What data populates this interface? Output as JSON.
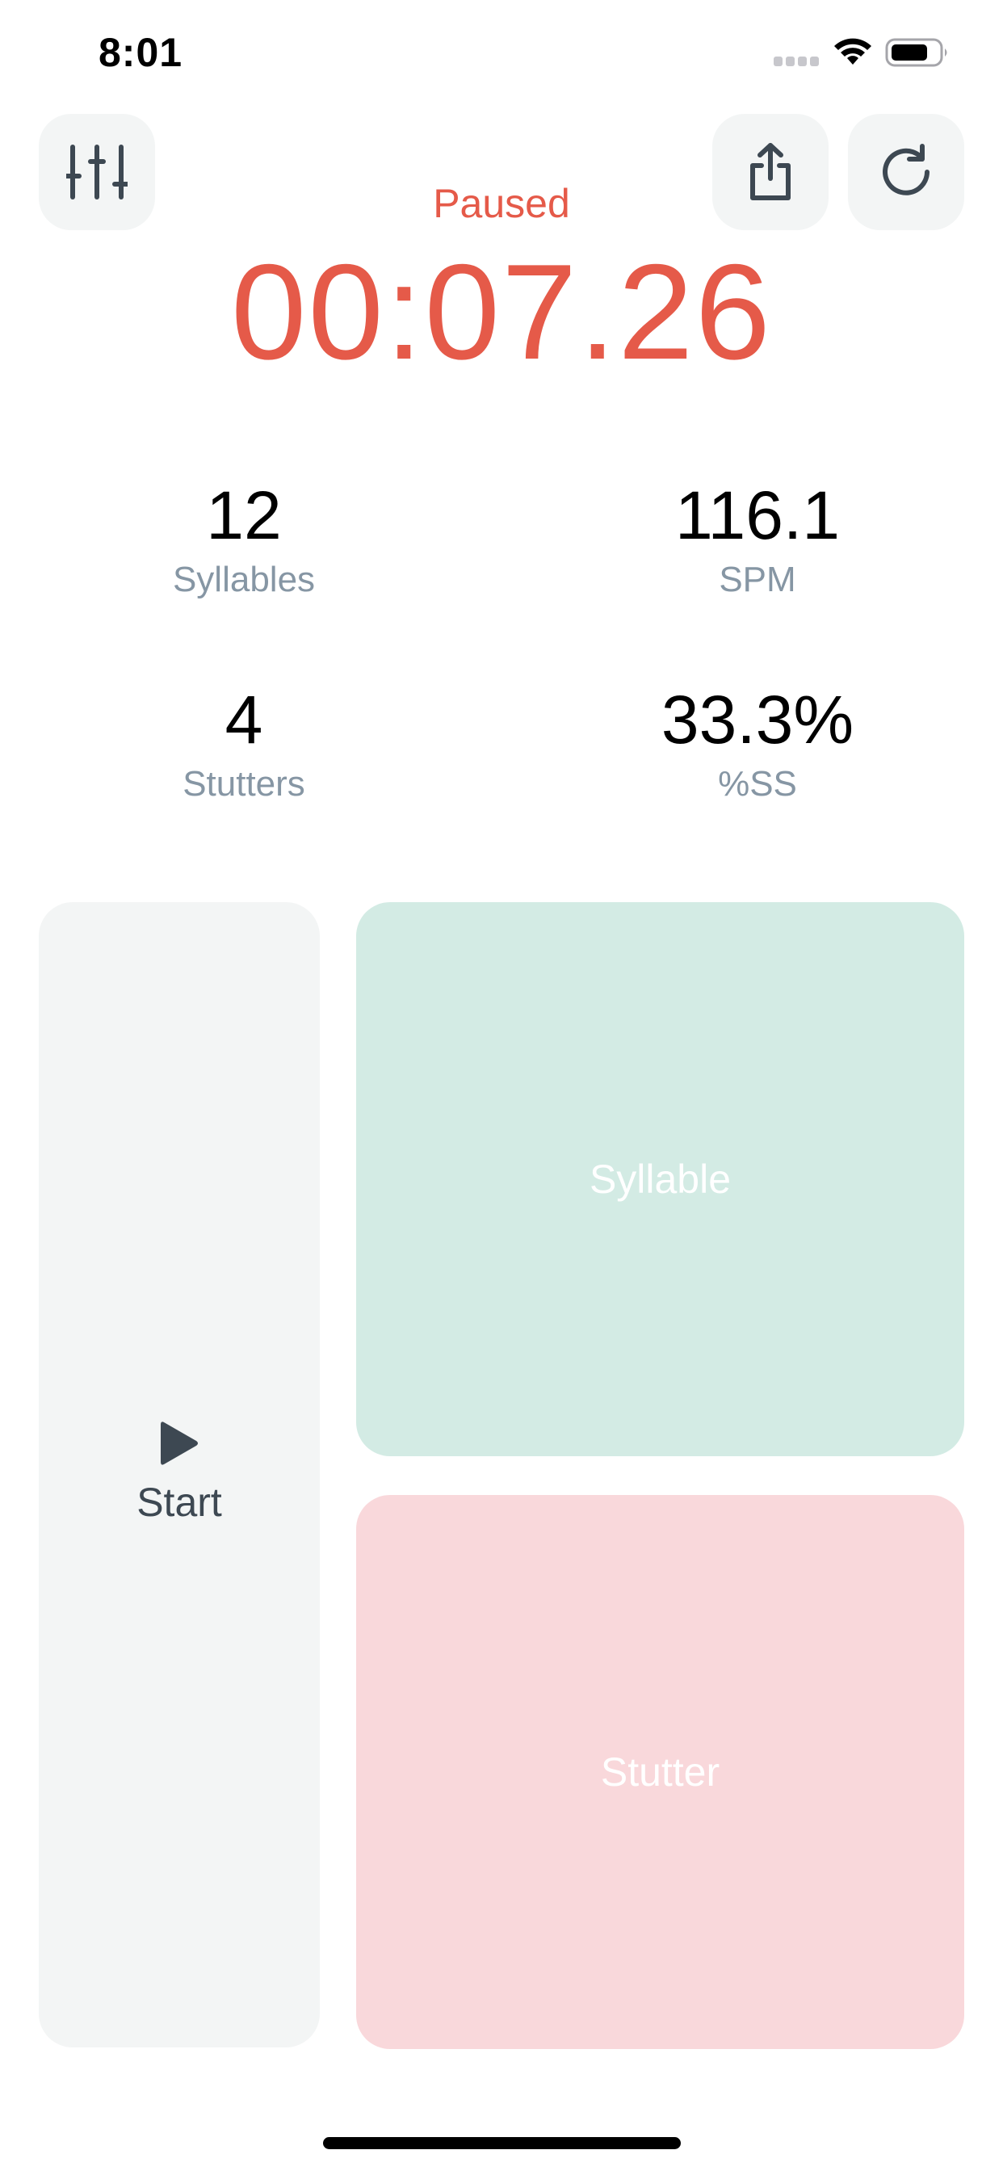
{
  "status_bar": {
    "time": "8:01",
    "icons": [
      "cellular-signal-icon",
      "wifi-icon",
      "battery-icon"
    ]
  },
  "toolbar": {
    "settings_icon": "sliders-icon",
    "share_icon": "share-icon",
    "reset_icon": "refresh-icon"
  },
  "timer": {
    "status": "Paused",
    "value": "00:07.26",
    "color": "#e55a49"
  },
  "stats": {
    "syllables": {
      "value": "12",
      "label": "Syllables"
    },
    "spm": {
      "value": "116.1",
      "label": "SPM"
    },
    "stutters": {
      "value": "4",
      "label": "Stutters"
    },
    "percent_ss": {
      "value": "33.3%",
      "label": "%SS"
    }
  },
  "controls": {
    "start": {
      "label": "Start",
      "icon": "play-icon",
      "color": "#f3f5f5"
    },
    "syllable": {
      "label": "Syllable",
      "color": "#d3ebe4"
    },
    "stutter": {
      "label": "Stutter",
      "color": "#f9d8db"
    }
  }
}
